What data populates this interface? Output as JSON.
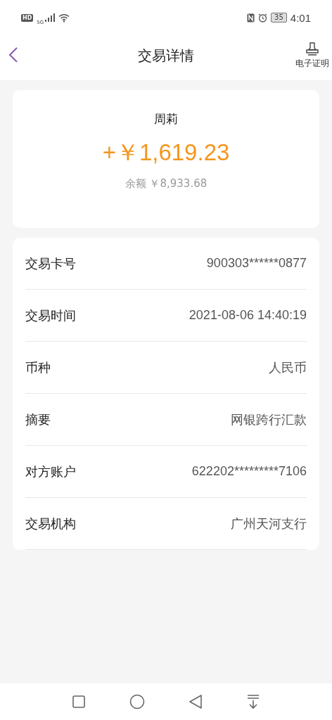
{
  "status_bar": {
    "hd": "HD",
    "network": "5G",
    "battery": "35",
    "time": "4:01"
  },
  "header": {
    "title": "交易详情",
    "action": "电子证明"
  },
  "summary": {
    "name": "周莉",
    "amount": "+￥1,619.23",
    "balance": "余额 ￥8,933.68"
  },
  "details": [
    {
      "label": "交易卡号",
      "value": "900303******0877"
    },
    {
      "label": "交易时间",
      "value": "2021-08-06 14:40:19"
    },
    {
      "label": "币种",
      "value": "人民币"
    },
    {
      "label": "摘要",
      "value": "网银跨行汇款"
    },
    {
      "label": "对方账户",
      "value": "622202*********7106"
    },
    {
      "label": "交易机构",
      "value": "广州天河支行"
    }
  ],
  "nav_bar": {
    "buttons": [
      {
        "kind": "square"
      },
      {
        "kind": "circle"
      },
      {
        "kind": "triangle"
      },
      {
        "kind": "pulldown"
      }
    ]
  }
}
